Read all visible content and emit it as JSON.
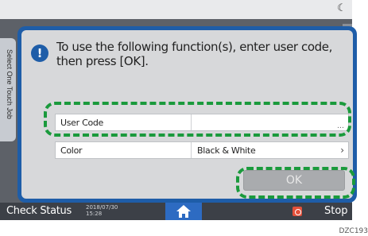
{
  "dialog": {
    "message": "To use the following function(s), enter user code, then press [OK].",
    "rows": [
      {
        "label": "User Code",
        "value": "",
        "trailing_icon": "ellipsis-icon"
      },
      {
        "label": "Color",
        "value": "Black & White",
        "trailing_icon": "chevron-right-icon"
      }
    ],
    "ok_label": "OK"
  },
  "side_tab": {
    "label": "Select One Touch Job"
  },
  "bottom_bar": {
    "check_status_label": "Check Status",
    "date": "2018/07/30",
    "time": "15:28",
    "stop_label": "Stop"
  },
  "figure_code": "DZC193",
  "colors": {
    "dialog_border": "#1e5da8",
    "highlight": "#1a9a3c",
    "ok_disabled": "#a9abae",
    "bottom_bar": "#3c4047"
  }
}
